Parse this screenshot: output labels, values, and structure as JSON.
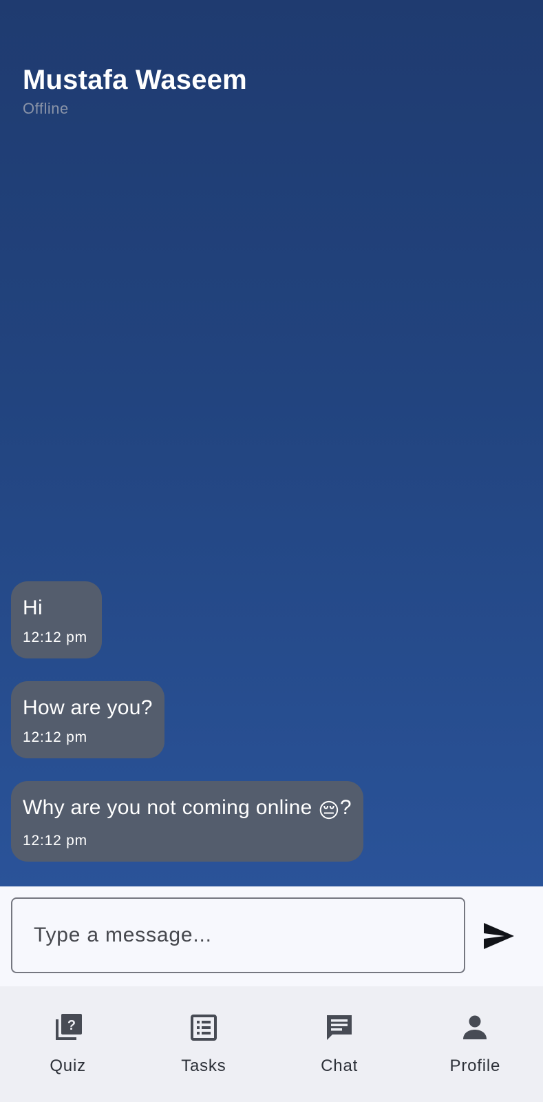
{
  "contact": {
    "name": "Mustafa Waseem",
    "status": "Offline"
  },
  "messages": [
    {
      "text": "Hi",
      "time": "12:12 pm"
    },
    {
      "text": "How are you?",
      "time": "12:12 pm"
    },
    {
      "text_before": "Why are you not coming online ",
      "emoji": "😔",
      "text_after": "?",
      "time": "12:12 pm"
    }
  ],
  "composer": {
    "placeholder": "Type a message...",
    "send_icon": "send-icon"
  },
  "nav": {
    "items": [
      {
        "label": "Quiz",
        "icon": "quiz-icon"
      },
      {
        "label": "Tasks",
        "icon": "tasks-icon"
      },
      {
        "label": "Chat",
        "icon": "chat-icon"
      },
      {
        "label": "Profile",
        "icon": "profile-icon"
      }
    ]
  },
  "colors": {
    "background_top": "#1f3b70",
    "background_bottom": "#2a5399",
    "bubble": "#545d6d",
    "status_text": "#8a94a8",
    "composer_bg": "#f7f8fd",
    "nav_bg": "#eeeff4"
  }
}
